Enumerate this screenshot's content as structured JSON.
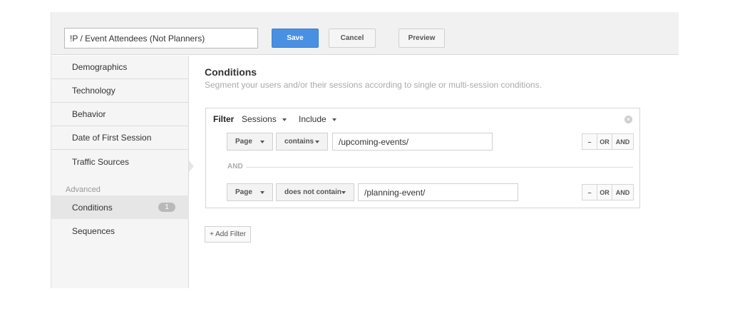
{
  "header": {
    "segment_name": "!P / Event Attendees (Not Planners)",
    "save_label": "Save",
    "cancel_label": "Cancel",
    "preview_label": "Preview"
  },
  "sidebar": {
    "items": [
      {
        "label": "Demographics"
      },
      {
        "label": "Technology"
      },
      {
        "label": "Behavior"
      },
      {
        "label": "Date of First Session"
      },
      {
        "label": "Traffic Sources"
      }
    ],
    "advanced_label": "Advanced",
    "advanced_items": [
      {
        "label": "Conditions",
        "badge": "1",
        "active": true
      },
      {
        "label": "Sequences"
      }
    ]
  },
  "main": {
    "title": "Conditions",
    "description": "Segment your users and/or their sessions according to single or multi-session conditions.",
    "filter": {
      "label": "Filter",
      "scope": "Sessions",
      "mode": "Include",
      "conditions": [
        {
          "dimension": "Page",
          "operator": "contains",
          "value": "/upcoming-events/"
        },
        {
          "dimension": "Page",
          "operator": "does not contain",
          "value": "/planning-event/"
        }
      ],
      "and_separator": "AND",
      "ops": {
        "minus": "–",
        "or": "OR",
        "and": "AND"
      }
    },
    "add_filter_label": "+ Add Filter"
  },
  "colors": {
    "save_button": "#4a90e2",
    "sidebar_bg": "#f5f5f5",
    "active_item_bg": "#e6e6e6"
  }
}
